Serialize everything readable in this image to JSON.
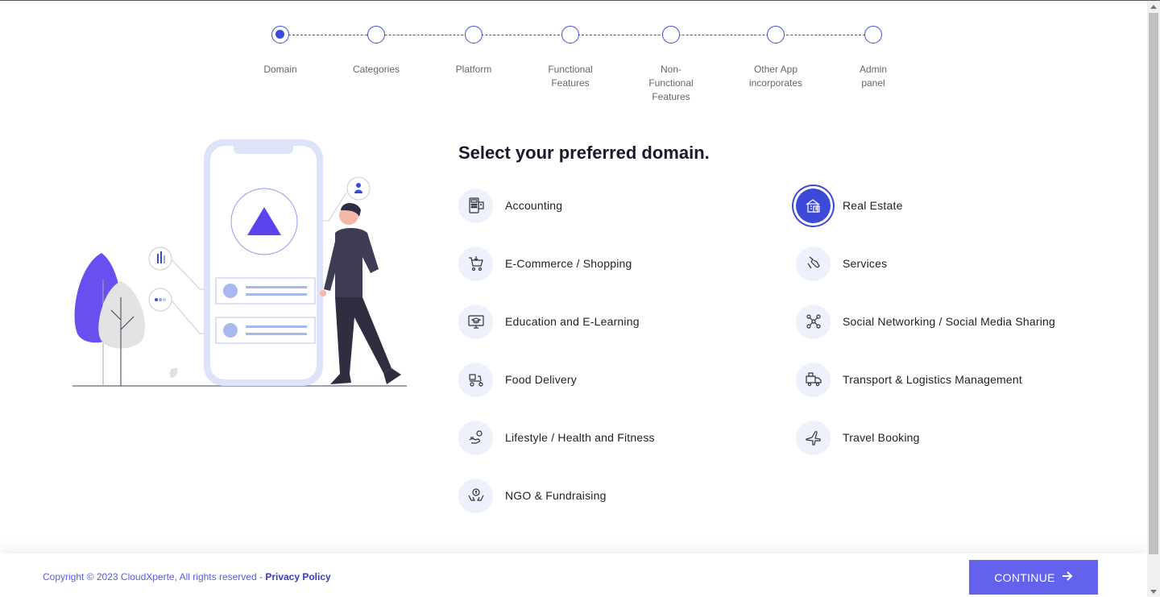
{
  "stepper": {
    "steps": [
      {
        "label": "Domain",
        "active": true
      },
      {
        "label": "Categories",
        "active": false
      },
      {
        "label": "Platform",
        "active": false
      },
      {
        "label": "Functional Features",
        "active": false
      },
      {
        "label": "Non-Functional Features",
        "active": false
      },
      {
        "label": "Other App incorporates",
        "active": false
      },
      {
        "label": "Admin panel",
        "active": false
      }
    ]
  },
  "main": {
    "heading": "Select your preferred domain.",
    "domains_left": [
      {
        "label": "Accounting",
        "icon": "calculator-icon"
      },
      {
        "label": "E-Commerce / Shopping",
        "icon": "shopping-cart-icon"
      },
      {
        "label": "Education and E-Learning",
        "icon": "monitor-graduation-icon"
      },
      {
        "label": "Food Delivery",
        "icon": "delivery-scooter-icon"
      },
      {
        "label": "Lifestyle / Health and Fitness",
        "icon": "fitness-icon"
      },
      {
        "label": "NGO & Fundraising",
        "icon": "donation-hands-icon"
      }
    ],
    "domains_right": [
      {
        "label": "Real Estate",
        "icon": "building-icon",
        "selected": true
      },
      {
        "label": "Services",
        "icon": "services-hand-icon"
      },
      {
        "label": "Social Networking / Social Media Sharing",
        "icon": "network-icon"
      },
      {
        "label": "Transport & Logistics Management",
        "icon": "truck-icon"
      },
      {
        "label": "Travel Booking",
        "icon": "airplane-icon"
      }
    ]
  },
  "footer": {
    "copyright": "Copyright © 2023 CloudXperte, All rights reserved - ",
    "privacy_label": "Privacy Policy",
    "continue_label": "CONTINUE"
  },
  "colors": {
    "accent": "#3b4ad8",
    "button": "#6262ec",
    "icon_bg": "#eef0fb"
  }
}
